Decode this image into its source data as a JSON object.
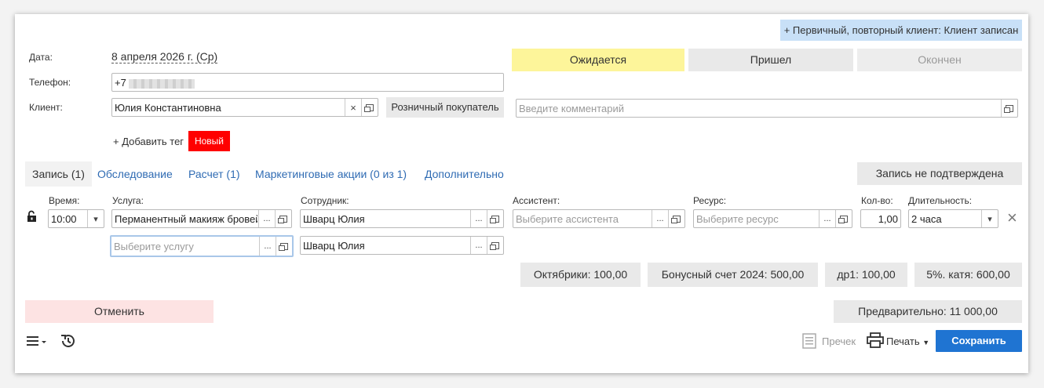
{
  "header": {
    "client_status_badge": "+ Первичный, повторный клиент: Клиент записан"
  },
  "form": {
    "date_label": "Дата:",
    "date_value": "8 апреля 2026 г. (Ср)",
    "phone_label": "Телефон:",
    "phone_value": "+7",
    "client_label": "Клиент:",
    "client_value": "Юлия Константиновна",
    "client_clear": "×",
    "client_type_button": "Розничный покупатель",
    "comment_placeholder": "Введите комментарий",
    "add_tag": "+ Добавить тег",
    "tag_new": "Новый"
  },
  "status_buttons": {
    "expected": "Ожидается",
    "came": "Пришел",
    "finished": "Окончен"
  },
  "tabs": [
    {
      "label": "Запись (1)"
    },
    {
      "label": "Обследование"
    },
    {
      "label": "Расчет (1)"
    },
    {
      "label": "Маркетинговые акции (0 из 1)"
    },
    {
      "label": "Дополнительно"
    }
  ],
  "confirm_button": "Запись не подтверждена",
  "service_table": {
    "headers": {
      "time": "Время:",
      "service": "Услуга:",
      "employee": "Сотрудник:",
      "assistant": "Ассистент:",
      "resource": "Ресурс:",
      "qty": "Кол-во:",
      "duration": "Длительность:"
    },
    "row1": {
      "time": "10:00",
      "service": "Перманентный макияж бровей",
      "employee": "Шварц Юлия",
      "assistant_placeholder": "Выберите ассистента",
      "resource_placeholder": "Выберите ресурс",
      "qty": "1,00",
      "duration": "2 часа"
    },
    "row2": {
      "service_placeholder": "Выберите услугу",
      "employee": "Шварц Юлия"
    },
    "ellipsis": "...",
    "remove": "×"
  },
  "bonuses": [
    {
      "label": "Октябрики: 100,00"
    },
    {
      "label": "Бонусный счет 2024: 500,00"
    },
    {
      "label": "др1: 100,00"
    },
    {
      "label": "5%. катя: 600,00"
    }
  ],
  "footer": {
    "cancel": "Отменить",
    "preliminary": "Предварительно: 11 000,00",
    "receipt": "Пречек",
    "print": "Печать",
    "save": "Сохранить"
  },
  "colors": {
    "expected_bg": "#fdf59a",
    "tag_bg": "#ff0000",
    "cancel_bg": "#fde3e3",
    "save_bg": "#1f74d2",
    "badge_bg": "#c8e0f7"
  }
}
